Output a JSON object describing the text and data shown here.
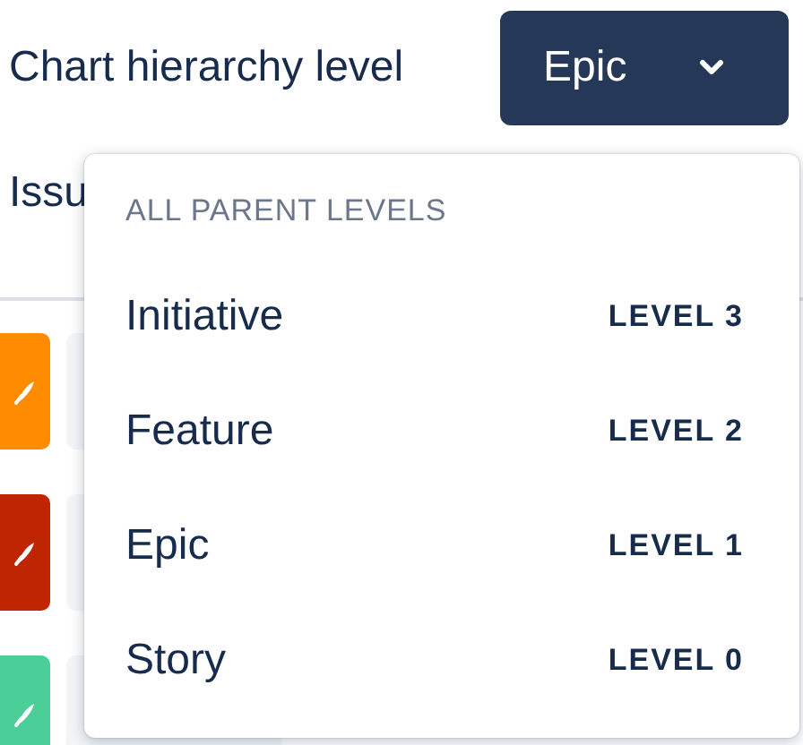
{
  "hierarchy": {
    "label": "Chart hierarchy level",
    "value": "Epic"
  },
  "background_header": "Issu",
  "issue_rows": [
    {
      "color": "#ff8b00"
    },
    {
      "color": "#bf2600"
    },
    {
      "color": "#4bce97"
    }
  ],
  "menu": {
    "heading": "ALL PARENT LEVELS",
    "items": [
      {
        "label": "Initiative",
        "level_text": "LEVEL 3"
      },
      {
        "label": "Feature",
        "level_text": "LEVEL 2"
      },
      {
        "label": "Epic",
        "level_text": "LEVEL 1"
      },
      {
        "label": "Story",
        "level_text": "LEVEL 0"
      }
    ]
  }
}
